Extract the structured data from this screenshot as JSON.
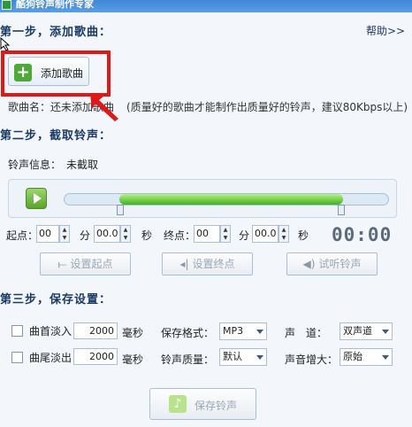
{
  "window": {
    "title": "酷狗铃声制作专家"
  },
  "step1": {
    "title": "第一步，添加歌曲：",
    "help": "帮助>>",
    "add_button": "添加歌曲",
    "song_label": "歌曲名：还未添加歌曲",
    "hint": "(质量好的歌曲才能制作出质量好的铃声，建议80Kbps以上)"
  },
  "step2": {
    "title": "第二步，截取铃声：",
    "info_label": "铃声信息：",
    "info_value": "未截取",
    "selection": {
      "start_fraction": 0.17,
      "end_fraction": 0.85
    },
    "start_label": "起点：",
    "end_label": "终点：",
    "start_min": "00",
    "start_sec": "00.0",
    "end_min": "00",
    "end_sec": "00.0",
    "unit_min": "分",
    "unit_sec": "秒",
    "clock": "00:00",
    "set_start_button": "设置起点",
    "set_end_button": "设置终点",
    "preview_button": "试听铃声"
  },
  "step3": {
    "title": "第三步，保存设置：",
    "fade_in_label": "曲首淡入",
    "fade_in_value": "2000",
    "fade_out_label": "曲尾淡出",
    "fade_out_value": "2000",
    "ms_unit": "毫秒",
    "format_label": "保存格式：",
    "format_value": "MP3",
    "quality_label": "铃声质量：",
    "quality_value": "默认",
    "channel_label": "声　道：",
    "channel_value": "双声道",
    "gain_label": "声音增大：",
    "gain_value": "原始",
    "save_button": "保存铃声"
  },
  "colors": {
    "accent": "#1a3a66",
    "highlight": "#e01818",
    "progress": "#3fb31c"
  }
}
